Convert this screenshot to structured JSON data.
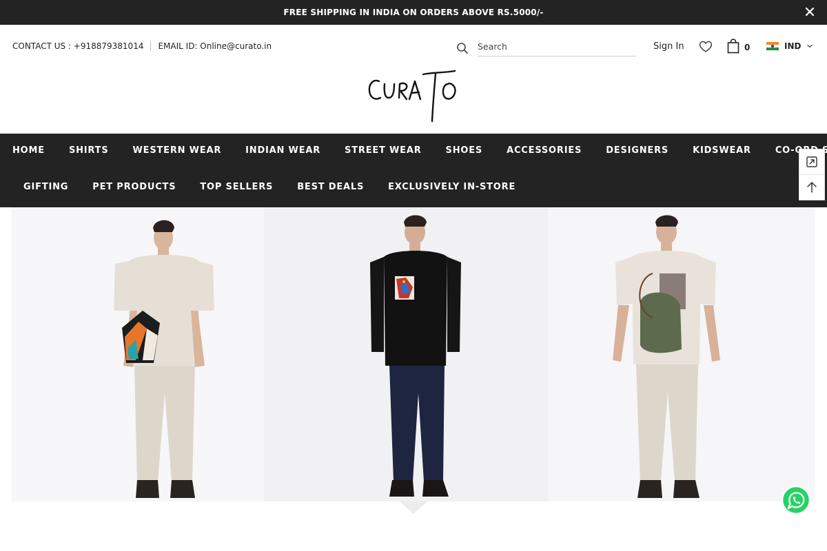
{
  "announcement": {
    "text": "FREE SHIPPING IN INDIA ON ORDERS ABOVE RS.5000/-",
    "close_icon": "close-icon"
  },
  "header": {
    "contact_label": "CONTACT US : +918879381014",
    "email_label": "EMAIL ID: Online@curato.in",
    "search": {
      "placeholder": "Search",
      "value": "",
      "icon": "search-icon"
    },
    "signin_label": "Sign In",
    "wishlist_icon": "heart-icon",
    "cart_icon": "shopping-bag-icon",
    "cart_count": "0",
    "currency": {
      "flag": "india-flag-icon",
      "label": "IND",
      "icon": "chevron-down-icon"
    },
    "logo_text": "CURATO"
  },
  "nav": {
    "row1": [
      "HOME",
      "SHIRTS",
      "WESTERN WEAR",
      "INDIAN WEAR",
      "STREET WEAR",
      "SHOES",
      "ACCESSORIES",
      "DESIGNERS",
      "KIDSWEAR",
      "CO-ORD SETS"
    ],
    "row2": [
      "GIFTING",
      "PET PRODUCTS",
      "TOP SELLERS",
      "BEST DEALS",
      "EXCLUSIVELY IN-STORE"
    ]
  },
  "side_tools": {
    "icons": [
      "compare-icon",
      "arrow-up-icon"
    ]
  },
  "hero": {
    "panels": [
      "model-horse-print-shirt",
      "model-black-shirt",
      "model-abstract-print-shirt"
    ]
  },
  "whatsapp_icon": "whatsapp-icon",
  "colors": {
    "dark_bar": "#232323",
    "hero_bg": "#f4f3f5",
    "whatsapp_green": "#25d366"
  }
}
